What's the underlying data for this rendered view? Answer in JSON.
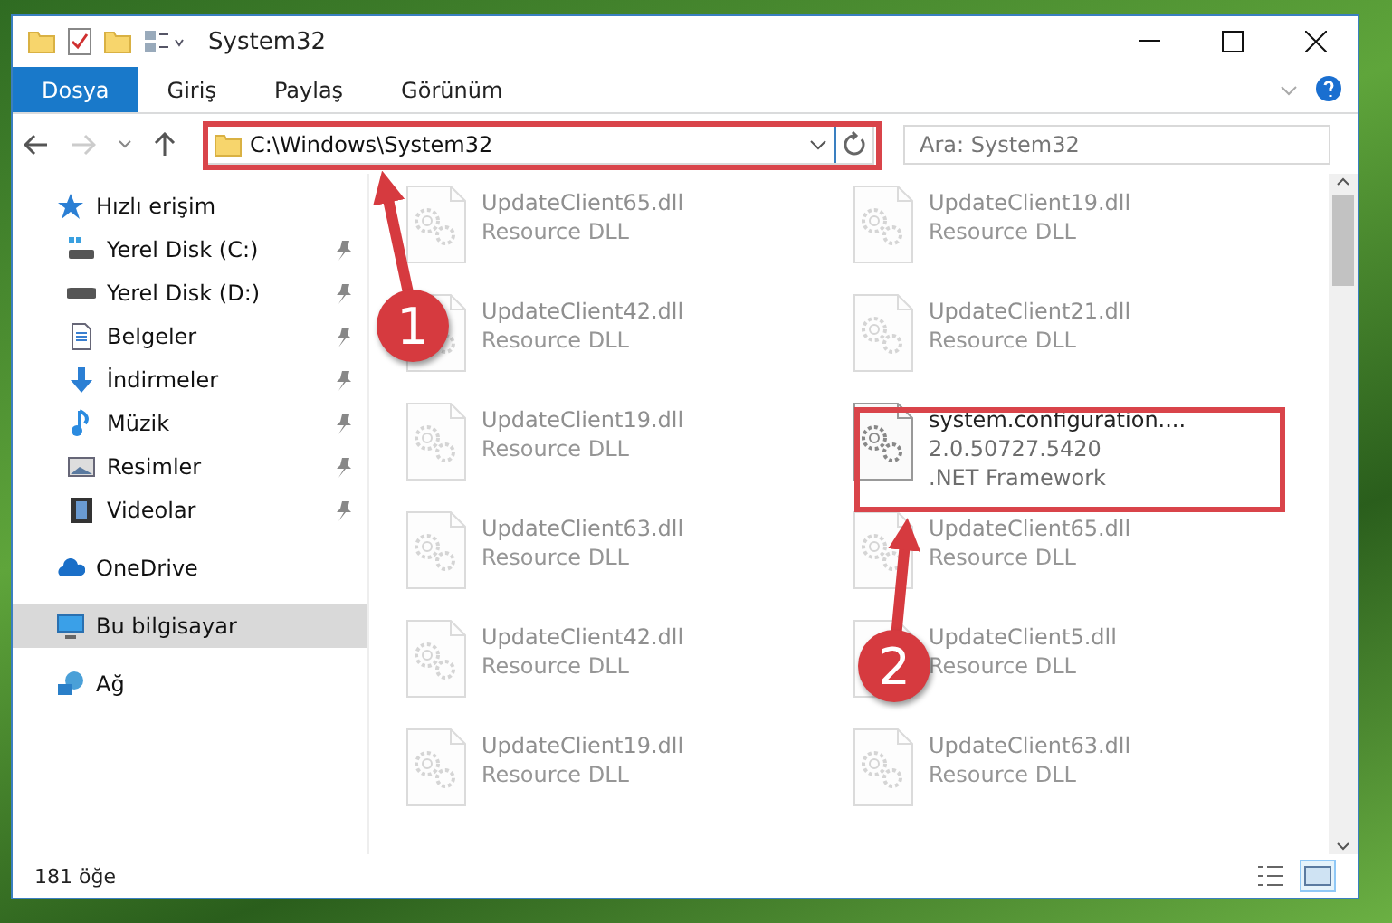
{
  "window": {
    "title": "System32"
  },
  "ribbon_tabs": [
    {
      "label": "Dosya",
      "kind": "file",
      "selected": false
    },
    {
      "label": "Giriş",
      "kind": "tab",
      "selected": false
    },
    {
      "label": "Paylaş",
      "kind": "tab",
      "selected": false
    },
    {
      "label": "Görünüm",
      "kind": "tab",
      "selected": false
    }
  ],
  "address": {
    "value": "C:\\Windows\\System32"
  },
  "search": {
    "placeholder": "Ara: System32"
  },
  "sidebar": {
    "items": [
      {
        "label": "Hızlı erişim",
        "selected": false,
        "children": [
          {
            "label": "Yerel Disk (C:)",
            "selected": false
          },
          {
            "label": "Yerel Disk (D:)",
            "selected": false
          },
          {
            "label": "Belgeler",
            "selected": false
          },
          {
            "label": "İndirmeler",
            "selected": false
          },
          {
            "label": "Müzik",
            "selected": false
          },
          {
            "label": "Resimler",
            "selected": false
          },
          {
            "label": "Videolar",
            "selected": false
          }
        ]
      },
      {
        "label": "OneDrive",
        "selected": false
      },
      {
        "label": "Bu bilgisayar",
        "selected": true
      },
      {
        "label": "Ağ",
        "selected": false
      }
    ]
  },
  "files": [
    {
      "name": "UpdateClient65.dll",
      "details": [
        "Resource DLL"
      ],
      "dimmed": true
    },
    {
      "name": "UpdateClient19.dll",
      "details": [
        "Resource DLL"
      ],
      "dimmed": true
    },
    {
      "name": "UpdateClient42.dll",
      "details": [
        "Resource DLL"
      ],
      "dimmed": true
    },
    {
      "name": "UpdateClient21.dll",
      "details": [
        "Resource DLL"
      ],
      "dimmed": true
    },
    {
      "name": "UpdateClient19.dll",
      "details": [
        "Resource DLL"
      ],
      "dimmed": true
    },
    {
      "name": "system.configuration....",
      "details": [
        "2.0.50727.5420",
        ".NET Framework"
      ],
      "dimmed": false
    },
    {
      "name": "UpdateClient63.dll",
      "details": [
        "Resource DLL"
      ],
      "dimmed": true
    },
    {
      "name": "UpdateClient65.dll",
      "details": [
        "Resource DLL"
      ],
      "dimmed": true
    },
    {
      "name": "UpdateClient42.dll",
      "details": [
        "Resource DLL"
      ],
      "dimmed": true
    },
    {
      "name": "UpdateClient5.dll",
      "details": [
        "Resource DLL"
      ],
      "dimmed": true
    },
    {
      "name": "UpdateClient19.dll",
      "details": [
        "Resource DLL"
      ],
      "dimmed": true
    },
    {
      "name": "UpdateClient63.dll",
      "details": [
        "Resource DLL"
      ],
      "dimmed": true
    }
  ],
  "status_bar": {
    "count": "181 öğe",
    "views": [
      {
        "kind": "details",
        "selected": false
      },
      {
        "kind": "tiles",
        "selected": true
      }
    ]
  },
  "annotations": [
    {
      "label": "1"
    },
    {
      "label": "2"
    }
  ]
}
